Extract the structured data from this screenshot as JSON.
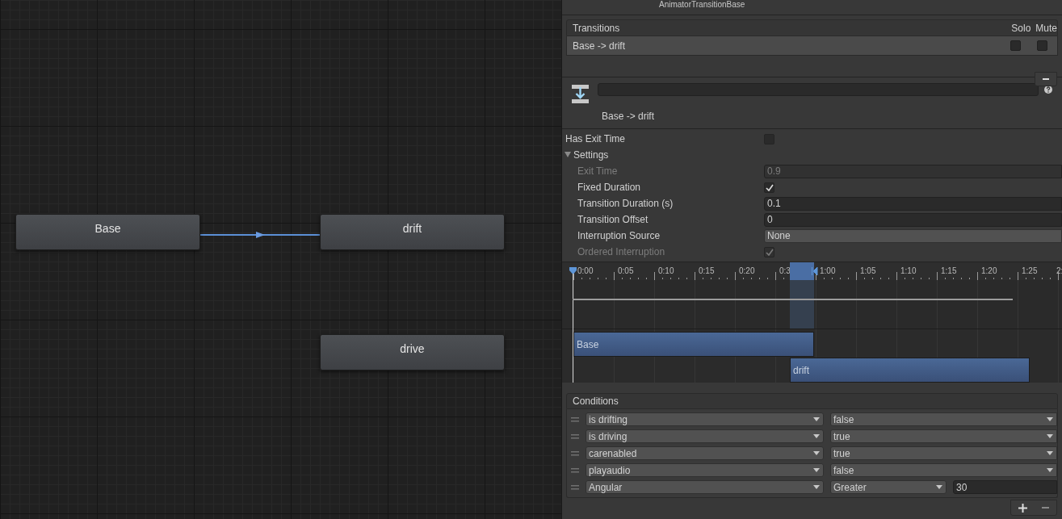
{
  "header": {
    "type_name": "AnimatorTransitionBase"
  },
  "graph": {
    "states": [
      {
        "name": "Base"
      },
      {
        "name": "drift"
      },
      {
        "name": "drive"
      }
    ]
  },
  "transitions": {
    "title": "Transitions",
    "columns": [
      "Solo",
      "Mute"
    ],
    "rows": [
      {
        "label": "Base -> drift",
        "selected": true,
        "solo": false,
        "mute": false
      }
    ]
  },
  "transition": {
    "title": "Base -> drift"
  },
  "properties": [
    {
      "kind": "checkbox",
      "label": "Has Exit Time",
      "checked": false
    },
    {
      "kind": "foldout",
      "label": "Settings",
      "expanded": true,
      "children": [
        {
          "kind": "number",
          "label": "Exit Time",
          "value": "0.9",
          "disabled": true
        },
        {
          "kind": "checkbox",
          "label": "Fixed Duration",
          "checked": true,
          "disabled": false
        },
        {
          "kind": "number",
          "label": "Transition Duration (s)",
          "value": "0.1",
          "disabled": false
        },
        {
          "kind": "number",
          "label": "Transition Offset",
          "value": "0",
          "disabled": false
        },
        {
          "kind": "dropdown",
          "label": "Interruption Source",
          "value": "None",
          "disabled": false
        },
        {
          "kind": "checkbox",
          "label": "Ordered Interruption",
          "checked": true,
          "disabled": true
        }
      ]
    }
  ],
  "timeline": {
    "ticks": [
      "0:00",
      "0:05",
      "0:10",
      "0:15",
      "0:20",
      "0:3",
      "1:00",
      "1:05",
      "1:10",
      "1:15",
      "1:20",
      "1:25",
      "2:"
    ],
    "tracks": [
      {
        "label": "Base"
      },
      {
        "label": "drift"
      }
    ]
  },
  "conditions": {
    "title": "Conditions",
    "rows": [
      {
        "parameter": "is drifting",
        "mode": "false"
      },
      {
        "parameter": "is driving",
        "mode": "true"
      },
      {
        "parameter": "carenabled",
        "mode": "true"
      },
      {
        "parameter": "playaudio",
        "mode": "false"
      },
      {
        "parameter": "Angular",
        "mode": "Greater",
        "threshold": "30"
      }
    ]
  }
}
